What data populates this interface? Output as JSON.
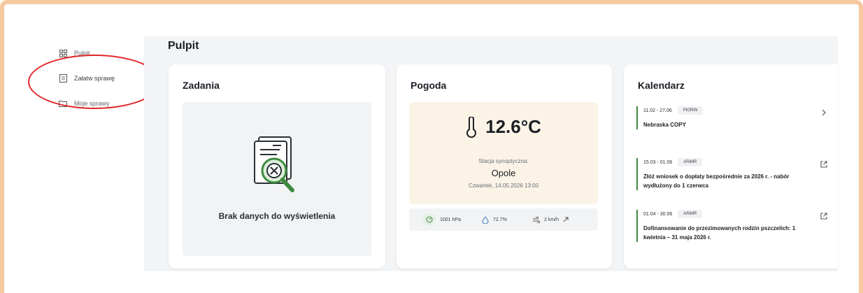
{
  "sidebar": {
    "items": [
      {
        "label": "Pulpit",
        "icon": "dashboard-icon"
      },
      {
        "label": "Załatw sprawę",
        "icon": "document-icon"
      },
      {
        "label": "Moje sprawy",
        "icon": "folder-icon"
      }
    ]
  },
  "page": {
    "title": "Pulpit"
  },
  "zadania": {
    "title": "Zadania",
    "empty_text": "Brak danych do wyświetlenia",
    "empty_icon": "document-search-icon"
  },
  "pogoda": {
    "title": "Pogoda",
    "temperature": "12.6°C",
    "station_label": "Stacja synoptyczna:",
    "station_name": "Opole",
    "date": "Czwartek, 14.05.2026 13:00",
    "pressure": "1001 hPa",
    "humidity": "72.7%",
    "wind": "2 km/h"
  },
  "kalendarz": {
    "title": "Kalendarz",
    "events": [
      {
        "dates": "11.02 - 27.06",
        "badge": "PIORIN",
        "title": "Nebraska COPY",
        "action_icon": "chevron-right-icon"
      },
      {
        "dates": "15.03 - 01.06",
        "badge": "ARiMR",
        "title": "Złóż wniosek o dopłaty bezpośrednie za 2026 r. - nabór wydłużony do 1 czerwca",
        "action_icon": "external-link-icon"
      },
      {
        "dates": "01.04 - 30.06",
        "badge": "ARiMR",
        "title": "Dofinansowanie do przezimowanych rodzin pszczelich: 1 kwietnia – 31 maja 2026 r.",
        "action_icon": "external-link-icon"
      }
    ]
  },
  "colors": {
    "frame_border": "#f6c9a0",
    "accent_green": "#3e8a3f",
    "highlight_red": "#e0262b",
    "weather_bg": "#fbf3e6"
  }
}
